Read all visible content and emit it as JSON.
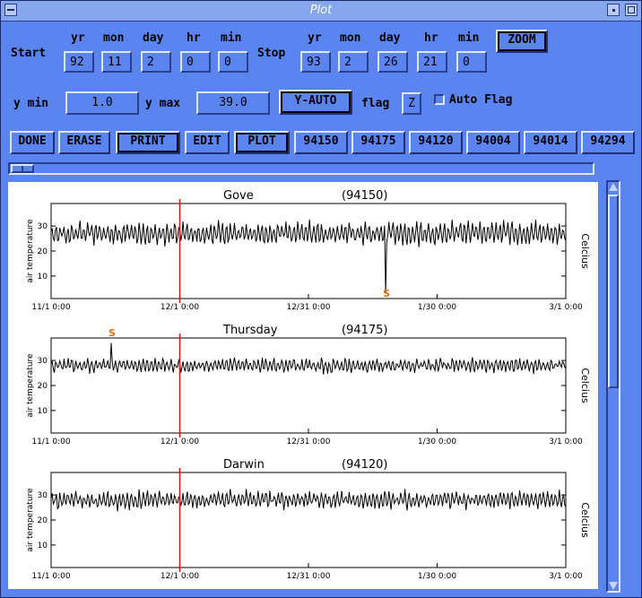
{
  "window": {
    "title": "Plot"
  },
  "start": {
    "label": "Start",
    "yr": "92",
    "mon": "11",
    "day": "2",
    "hr": "0",
    "min": "0"
  },
  "stop": {
    "label": "Stop",
    "yr": "93",
    "mon": "2",
    "day": "26",
    "hr": "21",
    "min": "0"
  },
  "column_headers": {
    "yr": "yr",
    "mon": "mon",
    "day": "day",
    "hr": "hr",
    "min": "min"
  },
  "zoom_label": "ZOOM",
  "ymin": {
    "label": "y min",
    "value": "1.0"
  },
  "ymax": {
    "label": "y max",
    "value": "39.0"
  },
  "yauto_label": "Y-AUTO",
  "flag": {
    "label": "flag",
    "value": "Z"
  },
  "autoflag": {
    "label": "Auto Flag",
    "checked": false
  },
  "toolbar": {
    "done": "DONE",
    "erase": "ERASE",
    "print": "PRINT",
    "edit": "EDIT",
    "plot": "PLOT"
  },
  "stations": [
    "94150",
    "94175",
    "94120",
    "94004",
    "94014",
    "94294"
  ],
  "colors": {
    "background": "#5a84f0",
    "marker": "#e01010",
    "flag": "#e07010"
  },
  "chart_data": [
    {
      "type": "line",
      "title": "Gove",
      "station_id": "(94150)",
      "ylabel": "air temperature",
      "right_label": "Celcius",
      "yticks": [
        "10",
        "20",
        "30"
      ],
      "ylim": [
        1,
        39
      ],
      "xticks": [
        "11/1 0:00",
        "12/1 0:00",
        "12/31 0:00",
        "1/30 0:00",
        "3/1 0:00"
      ],
      "xlim_days": [
        0,
        120
      ],
      "marker_day": 30,
      "flag": {
        "day": 78,
        "label": "S"
      },
      "spike": {
        "day": 78,
        "value": 3
      },
      "baseline": 27,
      "amplitude": 3.5
    },
    {
      "type": "line",
      "title": "Thursday",
      "station_id": "(94175)",
      "ylabel": "air temperature",
      "right_label": "Celcius",
      "yticks": [
        "10",
        "20",
        "30"
      ],
      "ylim": [
        1,
        39
      ],
      "xticks": [
        "11/1 0:00",
        "12/1 0:00",
        "12/31 0:00",
        "1/30 0:00",
        "3/1 0:00"
      ],
      "xlim_days": [
        0,
        120
      ],
      "marker_day": 30,
      "flag": {
        "day": 14,
        "label": "S"
      },
      "spike": {
        "day": 14,
        "value": 37
      },
      "baseline": 28,
      "amplitude": 2
    },
    {
      "type": "line",
      "title": "Darwin",
      "station_id": "(94120)",
      "ylabel": "air temperature",
      "right_label": "Celcius",
      "yticks": [
        "10",
        "20",
        "30"
      ],
      "ylim": [
        1,
        39
      ],
      "xticks": [
        "11/1 0:00",
        "12/1 0:00",
        "12/31 0:00",
        "1/30 0:00",
        "3/1 0:00"
      ],
      "xlim_days": [
        0,
        120
      ],
      "marker_day": 30,
      "baseline": 28,
      "amplitude": 2.5
    }
  ]
}
